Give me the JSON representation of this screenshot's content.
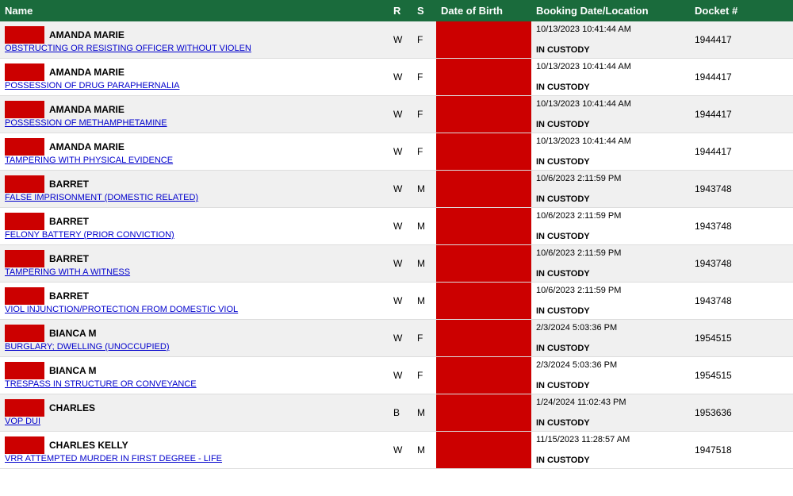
{
  "header": {
    "col_name": "Name",
    "col_r": "R",
    "col_s": "S",
    "col_dob": "Date of Birth",
    "col_booking": "Booking Date/Location",
    "col_docket": "Docket #"
  },
  "rows": [
    {
      "id": "row-1",
      "person_name": "AMANDA MARIE",
      "charge": "OBSTRUCTING OR RESISTING OFFICER WITHOUT VIOLEN",
      "race": "W",
      "sex": "F",
      "dob": "",
      "booking_date": "10/13/2023 10:41:44 AM",
      "booking_location": "IN CUSTODY",
      "docket": "1944417"
    },
    {
      "id": "row-2",
      "person_name": "AMANDA MARIE",
      "charge": "POSSESSION OF DRUG PARAPHERNALIA",
      "race": "W",
      "sex": "F",
      "dob": "",
      "booking_date": "10/13/2023 10:41:44 AM",
      "booking_location": "IN CUSTODY",
      "docket": "1944417"
    },
    {
      "id": "row-3",
      "person_name": "AMANDA MARIE",
      "charge": "POSSESSION OF METHAMPHETAMINE",
      "race": "W",
      "sex": "F",
      "dob": "",
      "booking_date": "10/13/2023 10:41:44 AM",
      "booking_location": "IN CUSTODY",
      "docket": "1944417"
    },
    {
      "id": "row-4",
      "person_name": "AMANDA MARIE",
      "charge": "TAMPERING WITH PHYSICAL EVIDENCE",
      "race": "W",
      "sex": "F",
      "dob": "",
      "booking_date": "10/13/2023 10:41:44 AM",
      "booking_location": "IN CUSTODY",
      "docket": "1944417"
    },
    {
      "id": "row-5",
      "person_name": "BARRET",
      "charge": "FALSE IMPRISONMENT (DOMESTIC RELATED)",
      "race": "W",
      "sex": "M",
      "dob": "",
      "booking_date": "10/6/2023 2:11:59 PM",
      "booking_location": "IN CUSTODY",
      "docket": "1943748"
    },
    {
      "id": "row-6",
      "person_name": "BARRET",
      "charge": "FELONY BATTERY (PRIOR CONVICTION)",
      "race": "W",
      "sex": "M",
      "dob": "",
      "booking_date": "10/6/2023 2:11:59 PM",
      "booking_location": "IN CUSTODY",
      "docket": "1943748"
    },
    {
      "id": "row-7",
      "person_name": "BARRET",
      "charge": "TAMPERING WITH A WITNESS",
      "race": "W",
      "sex": "M",
      "dob": "",
      "booking_date": "10/6/2023 2:11:59 PM",
      "booking_location": "IN CUSTODY",
      "docket": "1943748"
    },
    {
      "id": "row-8",
      "person_name": "BARRET",
      "charge": "VIOL INJUNCTION/PROTECTION FROM DOMESTIC VIOL",
      "race": "W",
      "sex": "M",
      "dob": "",
      "booking_date": "10/6/2023 2:11:59 PM",
      "booking_location": "IN CUSTODY",
      "docket": "1943748"
    },
    {
      "id": "row-9",
      "person_name": "BIANCA M",
      "charge": "BURGLARY; DWELLING (UNOCCUPIED)",
      "race": "W",
      "sex": "F",
      "dob": "",
      "booking_date": "2/3/2024 5:03:36 PM",
      "booking_location": "IN CUSTODY",
      "docket": "1954515"
    },
    {
      "id": "row-10",
      "person_name": "BIANCA M",
      "charge": "TRESPASS IN STRUCTURE OR CONVEYANCE",
      "race": "W",
      "sex": "F",
      "dob": "",
      "booking_date": "2/3/2024 5:03:36 PM",
      "booking_location": "IN CUSTODY",
      "docket": "1954515"
    },
    {
      "id": "row-11",
      "person_name": "CHARLES",
      "charge": "VOP DUI",
      "race": "B",
      "sex": "M",
      "dob": "",
      "booking_date": "1/24/2024 11:02:43 PM",
      "booking_location": "IN CUSTODY",
      "docket": "1953636"
    },
    {
      "id": "row-12",
      "person_name": "CHARLES KELLY",
      "charge": "VRR ATTEMPTED MURDER IN FIRST DEGREE - LIFE",
      "race": "W",
      "sex": "M",
      "dob": "",
      "booking_date": "11/15/2023 11:28:57 AM",
      "booking_location": "IN CUSTODY",
      "docket": "1947518"
    }
  ]
}
